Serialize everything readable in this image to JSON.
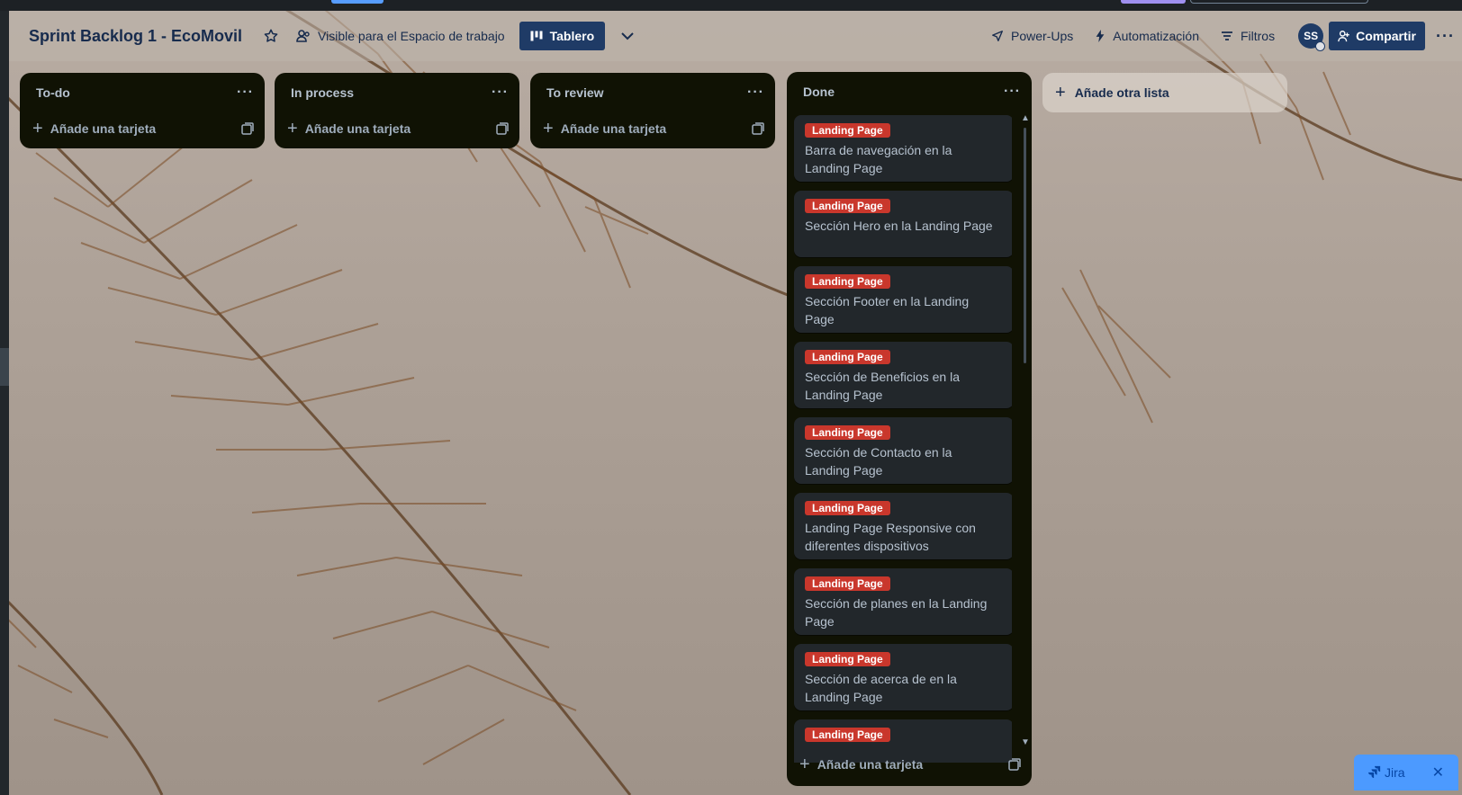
{
  "board": {
    "title": "Sprint Backlog 1 - EcoMovil",
    "visibility": "Visible para el Espacio de trabajo",
    "view": "Tablero",
    "powerups": "Power-Ups",
    "automation": "Automatización",
    "filters": "Filtros",
    "avatar_initials": "SS",
    "share": "Compartir"
  },
  "lists": [
    {
      "title": "To-do",
      "add_card": "Añade una tarjeta",
      "cards": []
    },
    {
      "title": "In process",
      "add_card": "Añade una tarjeta",
      "cards": []
    },
    {
      "title": "To review",
      "add_card": "Añade una tarjeta",
      "cards": []
    },
    {
      "title": "Done",
      "add_card": "Añade una tarjeta",
      "cards": [
        {
          "label": "Landing Page",
          "text": "Barra de navegación en la Landing Page"
        },
        {
          "label": "Landing Page",
          "text": "Sección Hero en la Landing Page"
        },
        {
          "label": "Landing Page",
          "text": "Sección Footer en la Landing Page"
        },
        {
          "label": "Landing Page",
          "text": "Sección de Beneficios en la Landing Page"
        },
        {
          "label": "Landing Page",
          "text": "Sección de Contacto en la Landing Page"
        },
        {
          "label": "Landing Page",
          "text": "Landing Page Responsive con diferentes dispositivos"
        },
        {
          "label": "Landing Page",
          "text": "Sección de planes en la Landing Page"
        },
        {
          "label": "Landing Page",
          "text": "Sección de acerca de en la Landing Page"
        },
        {
          "label": "Landing Page",
          "text": ""
        }
      ]
    }
  ],
  "add_list": "Añade otra lista",
  "jira": {
    "label": "Jira"
  },
  "colors": {
    "list_bg": "#101204",
    "card_bg": "#22272b",
    "label_red": "#c9372c",
    "header_button": "#1f3b66",
    "jira_blue": "#4c9aff"
  },
  "icons": [
    "star-icon",
    "workspace-icon",
    "board-icon",
    "chevron-down-icon",
    "rocket-icon",
    "lightning-icon",
    "filter-icon",
    "share-user-icon",
    "more-icon",
    "plus-icon",
    "template-icon",
    "close-icon"
  ]
}
